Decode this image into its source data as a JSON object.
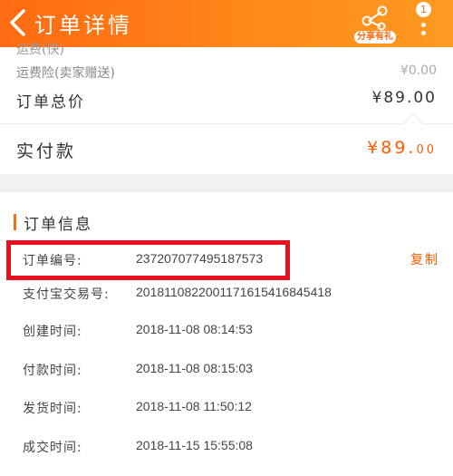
{
  "header": {
    "title": "订单详情",
    "share_label": "分享有礼",
    "badge_count": "1"
  },
  "summary": {
    "cut_text": "运费(快)",
    "shipping_label": "运费险(卖家赠送)",
    "shipping_value": "¥0.00",
    "total_label": "订单总价",
    "total_value": "¥89.00",
    "actual_label": "实付款",
    "actual_value_main": "¥89.",
    "actual_value_cents": "00"
  },
  "order_info": {
    "title": "订单信息",
    "copy_label": "复制",
    "rows": [
      {
        "label": "订单编号:",
        "value": "2372070774951875​73"
      },
      {
        "label": "支付宝交易号:",
        "value": "2018110822001171615416845418"
      },
      {
        "label": "创建时间:",
        "value": "2018-11-08 08:14:53"
      },
      {
        "label": "付款时间:",
        "value": "2018-11-08 08:15:03"
      },
      {
        "label": "发货时间:",
        "value": "2018-11-08 11:50:12"
      },
      {
        "label": "成交时间:",
        "value": "2018-11-15 15:55:08"
      }
    ]
  },
  "colors": {
    "accent": "#ff6a12",
    "price": "#ff5a00",
    "highlight_box": "#e8101e"
  }
}
